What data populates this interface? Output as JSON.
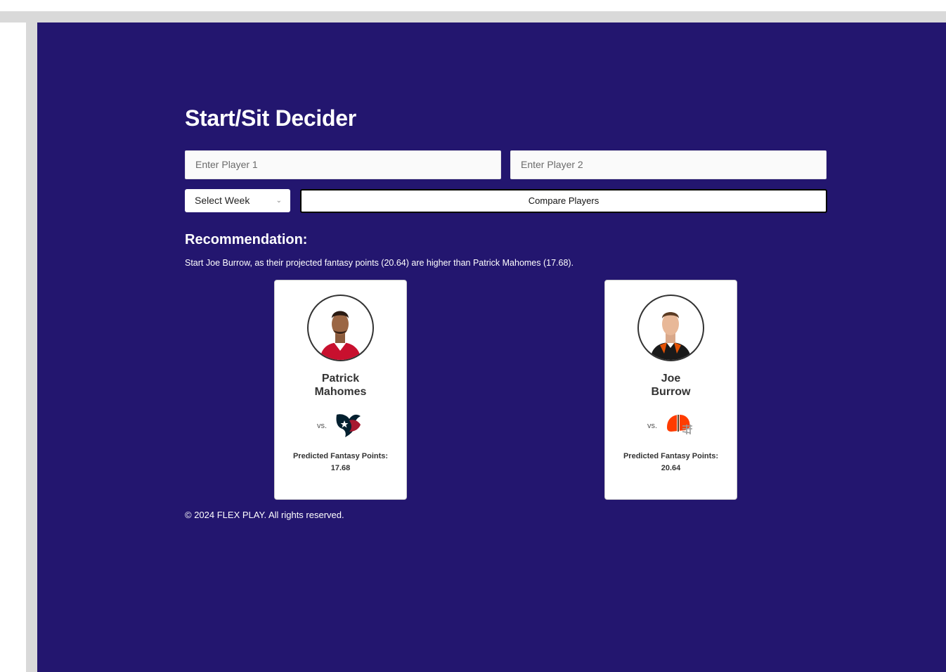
{
  "page": {
    "title": "Start/Sit Decider",
    "background_color": "#23166f"
  },
  "form": {
    "player1_placeholder": "Enter Player 1",
    "player2_placeholder": "Enter Player 2",
    "week_select": "Select Week",
    "compare_button": "Compare Players"
  },
  "recommendation": {
    "heading": "Recommendation:",
    "text": "Start Joe Burrow, as their projected fantasy points (20.64) are higher than Patrick Mahomes (17.68)."
  },
  "players": [
    {
      "first_name": "Patrick",
      "last_name": "Mahomes",
      "vs": "vs.",
      "opponent_logo": "texans-logo-icon",
      "points_label": "Predicted Fantasy Points:",
      "points": "17.68",
      "jersey_color": "#c8102e"
    },
    {
      "first_name": "Joe",
      "last_name": "Burrow",
      "vs": "vs.",
      "opponent_logo": "browns-helmet-icon",
      "points_label": "Predicted Fantasy Points:",
      "points": "20.64",
      "jersey_color": "#1a1a1a"
    }
  ],
  "footer": {
    "text": "© 2024 FLEX PLAY. All rights reserved."
  }
}
